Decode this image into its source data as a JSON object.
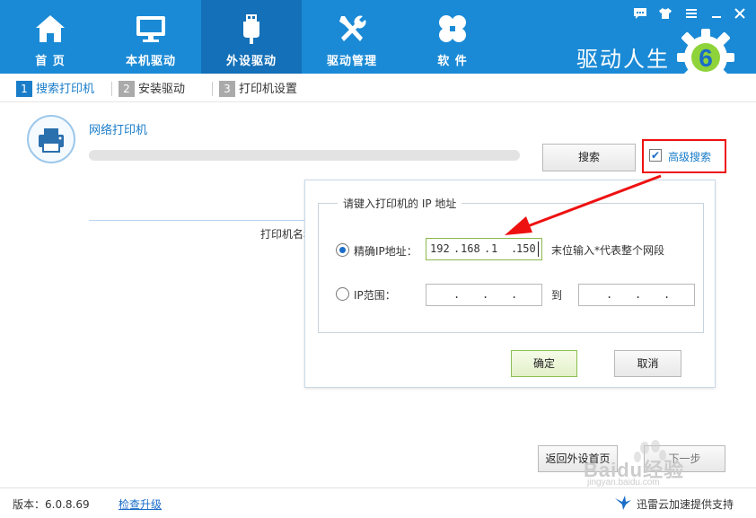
{
  "nav": {
    "tabs": [
      {
        "label": "首 页",
        "icon": "home-icon"
      },
      {
        "label": "本机驱动",
        "icon": "monitor-icon"
      },
      {
        "label": "外设驱动",
        "icon": "usb-icon"
      },
      {
        "label": "驱动管理",
        "icon": "tools-icon"
      },
      {
        "label": "软 件",
        "icon": "apps-icon"
      }
    ],
    "brand": "驱动人生",
    "logo_digit": "6"
  },
  "steps": [
    {
      "num": "1",
      "label": "搜索打印机"
    },
    {
      "num": "2",
      "label": "安装驱动"
    },
    {
      "num": "3",
      "label": "打印机设置"
    }
  ],
  "content": {
    "section_title": "网络打印机",
    "search_label": "搜索",
    "advanced_label": "高级搜索",
    "advanced_checked": true,
    "column_header": "打印机名称",
    "progress": 0
  },
  "popup": {
    "legend": "请键入打印机的 IP 地址",
    "exact_label": "精确IP地址：",
    "exact_ip": [
      "192",
      "168",
      "1",
      "150"
    ],
    "hint": "末位输入*代表整个网段",
    "range_label": "IP范围：",
    "range_to": "到",
    "ok_label": "确定",
    "cancel_label": "取消"
  },
  "actions": {
    "back_label": "返回外设首页",
    "next_label": "下一步"
  },
  "footer": {
    "version": "版本：6.0.8.69",
    "update_label": "检查升级",
    "support": "迅雷云加速提供支持"
  },
  "watermark": {
    "text": "Baidu经验",
    "sub": "jingyan.baidu.com"
  },
  "colors": {
    "topbar": "#1a8ad6",
    "active_tab": "#1470b8",
    "accent": "#1a7dc9",
    "highlight": "#e11111"
  }
}
